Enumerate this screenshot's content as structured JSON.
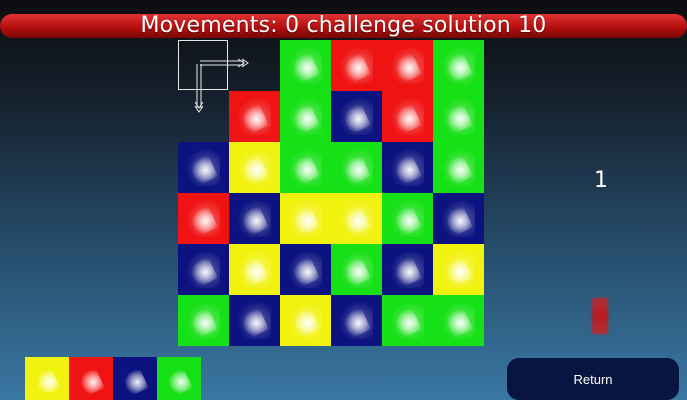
{
  "header": {
    "title": "Movements: 0 challenge solution 10"
  },
  "colors": {
    "green": "#16e016",
    "red": "#f01313",
    "blue": "#0c1380",
    "yellow": "#f2f20f",
    "topbar": "#c81a1a",
    "return_bg": "#071540"
  },
  "board": {
    "rows": [
      [
        null,
        null,
        "green",
        "red",
        "red",
        "green"
      ],
      [
        null,
        "red",
        "green",
        "blue",
        "red",
        "green"
      ],
      [
        "blue",
        "yellow",
        "green",
        "green",
        "blue",
        "green"
      ],
      [
        "red",
        "blue",
        "yellow",
        "yellow",
        "green",
        "blue"
      ],
      [
        "blue",
        "yellow",
        "blue",
        "green",
        "blue",
        "yellow"
      ],
      [
        "green",
        "blue",
        "yellow",
        "blue",
        "green",
        "green"
      ]
    ]
  },
  "side": {
    "counter": "1"
  },
  "palette": {
    "colors": [
      "yellow",
      "red",
      "blue",
      "green"
    ]
  },
  "buttons": {
    "return_label": "Return"
  }
}
